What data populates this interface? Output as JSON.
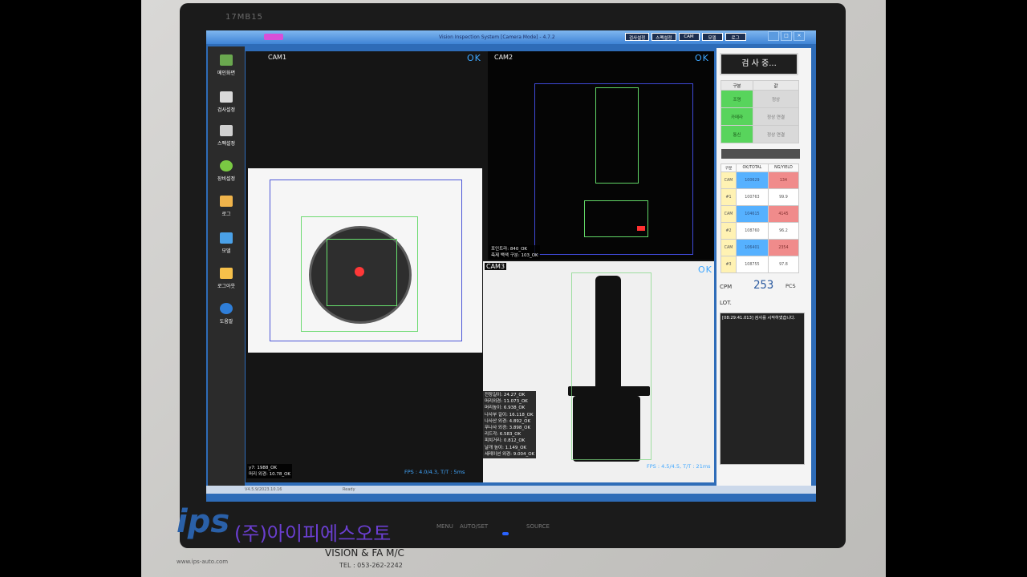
{
  "monitor": {
    "model": "17MB15"
  },
  "titlebar": {
    "title": "Vision Inspection System [Camera Mode] - 4.7.2",
    "menu": [
      "검사설정",
      "스펙설정",
      "CAM",
      "모델",
      "로그"
    ],
    "win_ctrls": [
      "",
      "□",
      "×"
    ]
  },
  "sidebar": {
    "items": [
      {
        "label": "메인화면",
        "icon": "camera-icon"
      },
      {
        "label": "검사설정",
        "icon": "settings-grid-icon"
      },
      {
        "label": "스펙설정",
        "icon": "clipboard-icon"
      },
      {
        "label": "장비설정",
        "icon": "gear-icon"
      },
      {
        "label": "로그",
        "icon": "log-book-icon"
      },
      {
        "label": "모델",
        "icon": "monitor-icon"
      },
      {
        "label": "로그아웃",
        "icon": "key-icon"
      },
      {
        "label": "도움말",
        "icon": "help-icon"
      }
    ]
  },
  "cam1": {
    "label": "CAM1",
    "ok": "OK",
    "overlay": [
      "y7: 1988_OK",
      "머리 외경: 10.78_OK"
    ],
    "fps": "FPS : 4.0/4.3, T/T : 5ms"
  },
  "cam2": {
    "label": "CAM2",
    "ok": "OK",
    "overlay": [
      "포인트라: 840_OK",
      "측제 백색 구분: 103_OK"
    ],
    "fps": ""
  },
  "cam3": {
    "label": "CAM3",
    "ok": "OK",
    "overlay": [
      "전장길이: 24.27_OK",
      "머리외경: 11.073_OK",
      "머리높이: 6.938_OK",
      "나사부 길이: 16.118_OK",
      "나사산 외경: 4.892_OK",
      "무나사 외경: 3.898_OK",
      "리드각: 6.583_OK",
      "피치거리: 0.812_OK",
      "날개 높이: 1.149_OK",
      "세레이션 외경: 9.004_OK"
    ],
    "fps": "FPS : 4.5/4.5, T/T : 21ms"
  },
  "right_panel": {
    "status": "검 사 중...",
    "status_rows": [
      {
        "name": "구분",
        "value": "값"
      },
      {
        "name": "조명",
        "value": "정상"
      },
      {
        "name": "카메라",
        "value": "정상 연결"
      },
      {
        "name": "통신",
        "value": "정상 연결"
      }
    ],
    "stats_header": [
      "구분",
      "OK/TOTAL",
      "NG/YIELD"
    ],
    "stats_rows": [
      [
        "CAM",
        "100629",
        "134"
      ],
      [
        "#1",
        "100763",
        "99.9"
      ],
      [
        "CAM",
        "104615",
        "4145"
      ],
      [
        "#2",
        "108760",
        "96.2"
      ],
      [
        "CAM",
        "106401",
        "2354"
      ],
      [
        "#3",
        "108755",
        "97.8"
      ]
    ],
    "cpm_label": "CPM",
    "cpm_value": "253",
    "cpm_unit": "PCS",
    "lot_label": "LOT.",
    "log": "[08:29:41.013] 검사를 시작하였습니다."
  },
  "statusbar": {
    "version": "V4.5.9/2023.10.16",
    "ready": "Ready"
  },
  "hardware": {
    "buttons": [
      "MENU",
      "AUTO/SET",
      "SOURCE"
    ]
  },
  "brand": {
    "ips": "ips",
    "company": "(주)아이피에스오토",
    "vision": "VISION & FA M/C",
    "url": "www.ips-auto.com",
    "tel": "TEL : 053-262-2242"
  }
}
